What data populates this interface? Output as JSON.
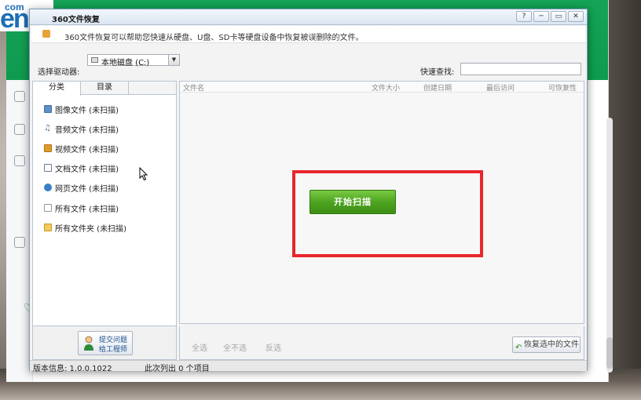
{
  "logo": {
    "small": "com",
    "large": "en"
  },
  "dialog": {
    "title": "360文件恢复",
    "info": "360文件恢复可以帮助您快速从硬盘、U盘、SD卡等硬盘设备中恢复被误删除的文件。",
    "drive_label": "选择驱动器:",
    "drive_value": "本地磁盘 (C:)",
    "search_label": "快速查找:",
    "search_value": "",
    "tabs": [
      "分类",
      "目录"
    ],
    "categories": [
      {
        "label": "图像文件 (未扫描)",
        "icon": "image-icon"
      },
      {
        "label": "音频文件 (未扫描)",
        "icon": "audio-icon"
      },
      {
        "label": "视频文件 (未扫描)",
        "icon": "video-icon"
      },
      {
        "label": "文档文件 (未扫描)",
        "icon": "document-icon"
      },
      {
        "label": "网页文件 (未扫描)",
        "icon": "webpage-icon"
      },
      {
        "label": "所有文件 (未扫描)",
        "icon": "file-icon"
      },
      {
        "label": "所有文件夹 (未扫描)",
        "icon": "folder-icon"
      }
    ],
    "columns": [
      "文件名",
      "文件大小",
      "创建日期",
      "最后访问",
      "可恢复性"
    ],
    "scan_button": "开始扫描",
    "feedback": {
      "line1": "提交问题",
      "line2": "给工程师"
    },
    "select_all": "全选",
    "select_none": "全不选",
    "select_invert": "反选",
    "restore_button": "恢复选中的文件",
    "version": "版本信息: 1.0.0.1022",
    "listed": "此次列出 0 个项目"
  },
  "colors": {
    "accent_green": "#4ea421",
    "highlight_red": "#e8262c",
    "host_green": "#12a054"
  }
}
